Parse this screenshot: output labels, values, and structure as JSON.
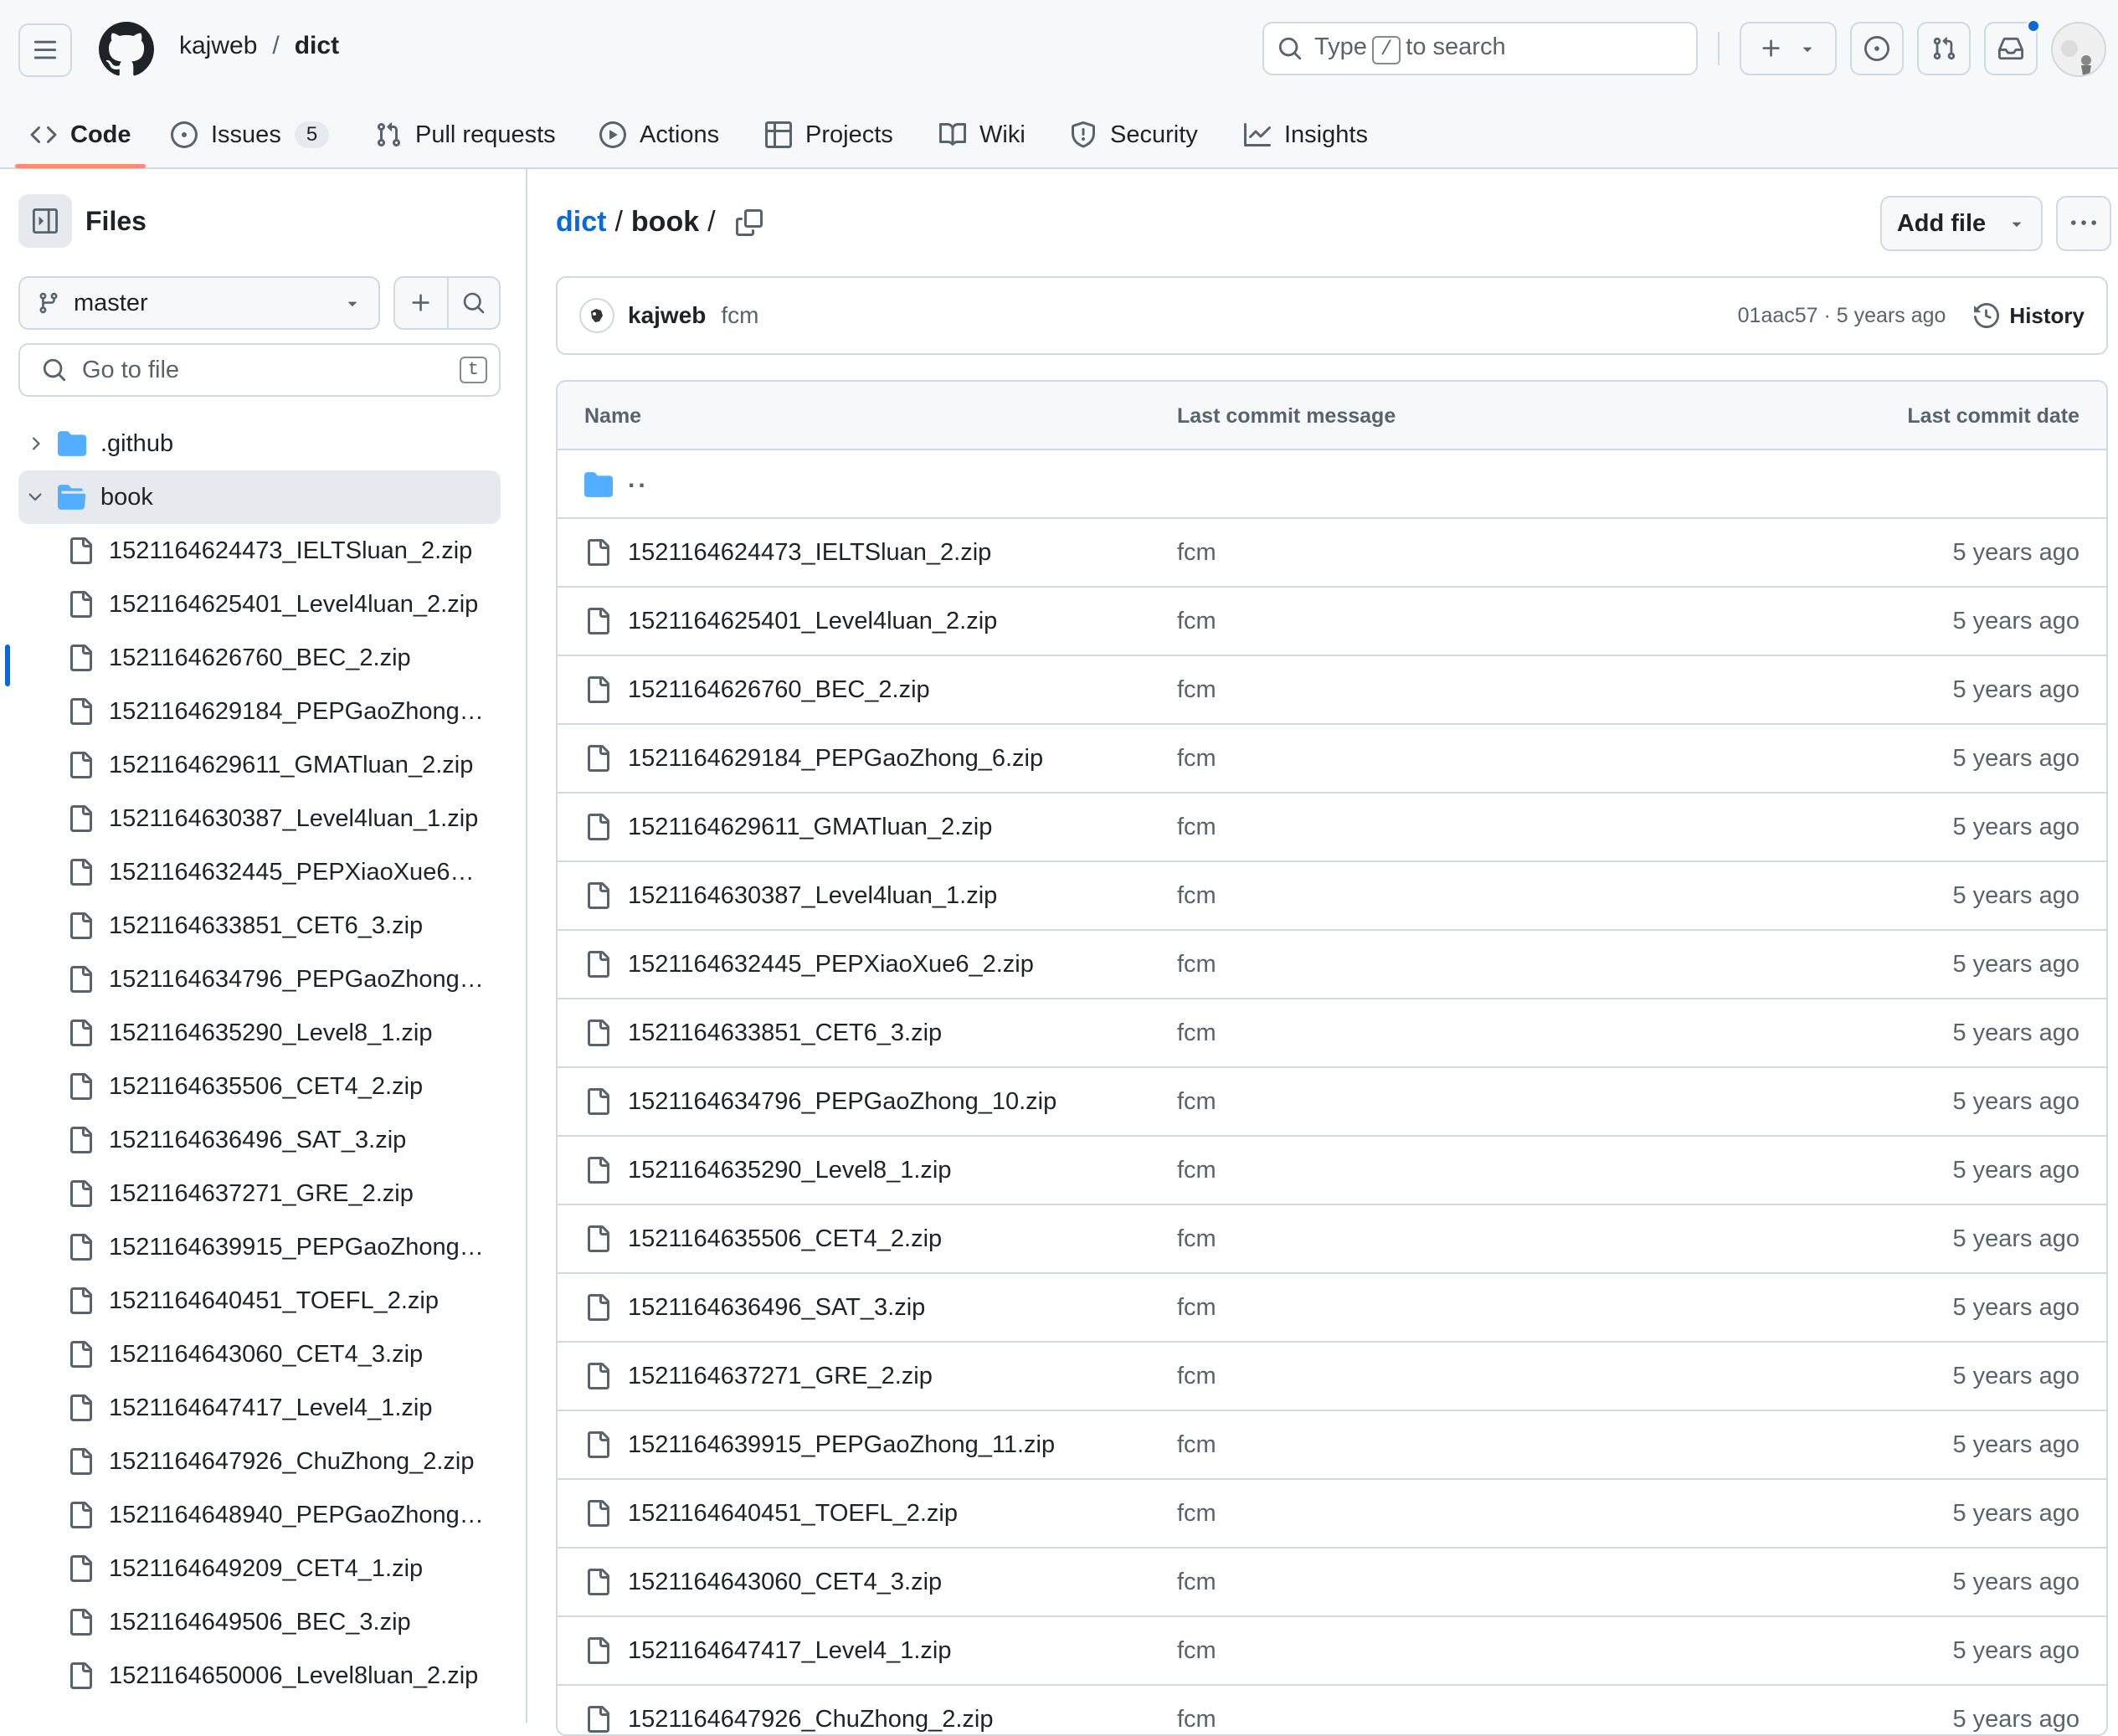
{
  "header": {
    "owner": "kajweb",
    "separator": "/",
    "repo": "dict",
    "search": {
      "prefix": "Type",
      "key": "/",
      "suffix": "to search"
    }
  },
  "tabs": [
    {
      "label": "Code",
      "icon": "code-icon"
    },
    {
      "label": "Issues",
      "icon": "issue-opened-icon",
      "count": "5"
    },
    {
      "label": "Pull requests",
      "icon": "git-pull-request-icon"
    },
    {
      "label": "Actions",
      "icon": "play-icon"
    },
    {
      "label": "Projects",
      "icon": "table-icon"
    },
    {
      "label": "Wiki",
      "icon": "book-icon"
    },
    {
      "label": "Security",
      "icon": "shield-icon"
    },
    {
      "label": "Insights",
      "icon": "graph-icon"
    }
  ],
  "sidebar": {
    "title": "Files",
    "branch": "master",
    "goto_placeholder": "Go to file",
    "goto_key": "t",
    "folders": [
      {
        "name": ".github",
        "expanded": false
      },
      {
        "name": "book",
        "expanded": true
      }
    ],
    "files": [
      "1521164624473_IELTSluan_2.zip",
      "1521164625401_Level4luan_2.zip",
      "1521164626760_BEC_2.zip",
      "1521164629184_PEPGaoZhong_6.zip",
      "1521164629611_GMATluan_2.zip",
      "1521164630387_Level4luan_1.zip",
      "1521164632445_PEPXiaoXue6_2.zip",
      "1521164633851_CET6_3.zip",
      "1521164634796_PEPGaoZhong_10.zip",
      "1521164635290_Level8_1.zip",
      "1521164635506_CET4_2.zip",
      "1521164636496_SAT_3.zip",
      "1521164637271_GRE_2.zip",
      "1521164639915_PEPGaoZhong_11.zip",
      "1521164640451_TOEFL_2.zip",
      "1521164643060_CET4_3.zip",
      "1521164647417_Level4_1.zip",
      "1521164647926_ChuZhong_2.zip",
      "1521164648940_PEPGaoZhong_...",
      "1521164649209_CET4_1.zip",
      "1521164649506_BEC_3.zip",
      "1521164650006_Level8luan_2.zip"
    ]
  },
  "main": {
    "path": {
      "repo": "dict",
      "folder": "book",
      "sep": "/"
    },
    "add_file_label": "Add file",
    "commit": {
      "author": "kajweb",
      "message": "fcm",
      "meta": "01aac57 · 5 years ago",
      "history_label": "History"
    },
    "table": {
      "headers": {
        "name": "Name",
        "message": "Last commit message",
        "date": "Last commit date"
      },
      "parent": "..",
      "rows": [
        {
          "name": "1521164624473_IELTSluan_2.zip",
          "msg": "fcm",
          "date": "5 years ago"
        },
        {
          "name": "1521164625401_Level4luan_2.zip",
          "msg": "fcm",
          "date": "5 years ago"
        },
        {
          "name": "1521164626760_BEC_2.zip",
          "msg": "fcm",
          "date": "5 years ago"
        },
        {
          "name": "1521164629184_PEPGaoZhong_6.zip",
          "msg": "fcm",
          "date": "5 years ago"
        },
        {
          "name": "1521164629611_GMATluan_2.zip",
          "msg": "fcm",
          "date": "5 years ago"
        },
        {
          "name": "1521164630387_Level4luan_1.zip",
          "msg": "fcm",
          "date": "5 years ago"
        },
        {
          "name": "1521164632445_PEPXiaoXue6_2.zip",
          "msg": "fcm",
          "date": "5 years ago"
        },
        {
          "name": "1521164633851_CET6_3.zip",
          "msg": "fcm",
          "date": "5 years ago"
        },
        {
          "name": "1521164634796_PEPGaoZhong_10.zip",
          "msg": "fcm",
          "date": "5 years ago"
        },
        {
          "name": "1521164635290_Level8_1.zip",
          "msg": "fcm",
          "date": "5 years ago"
        },
        {
          "name": "1521164635506_CET4_2.zip",
          "msg": "fcm",
          "date": "5 years ago"
        },
        {
          "name": "1521164636496_SAT_3.zip",
          "msg": "fcm",
          "date": "5 years ago"
        },
        {
          "name": "1521164637271_GRE_2.zip",
          "msg": "fcm",
          "date": "5 years ago"
        },
        {
          "name": "1521164639915_PEPGaoZhong_11.zip",
          "msg": "fcm",
          "date": "5 years ago"
        },
        {
          "name": "1521164640451_TOEFL_2.zip",
          "msg": "fcm",
          "date": "5 years ago"
        },
        {
          "name": "1521164643060_CET4_3.zip",
          "msg": "fcm",
          "date": "5 years ago"
        },
        {
          "name": "1521164647417_Level4_1.zip",
          "msg": "fcm",
          "date": "5 years ago"
        },
        {
          "name": "1521164647926_ChuZhong_2.zip",
          "msg": "fcm",
          "date": "5 years ago"
        }
      ]
    }
  },
  "colors": {
    "accent": "#0969da",
    "tab_underline": "#fd8c73",
    "folder": "#54aeff",
    "muted": "#59636e",
    "border": "#d1d9e0"
  }
}
